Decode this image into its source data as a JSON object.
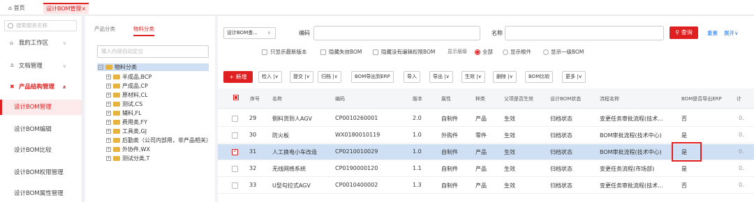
{
  "tabs": [
    {
      "label": "首页",
      "icon": "home-icon",
      "active": false
    },
    {
      "label": "设计BOM管理",
      "active": true,
      "close": "×"
    }
  ],
  "nav": {
    "search_placeholder": "搜索服务名称",
    "items": [
      {
        "label": "我的工作区",
        "icon": "home-icon"
      },
      {
        "label": "文档管理",
        "icon": "document-icon"
      },
      {
        "label": "产品结构管理",
        "icon": "structure-icon",
        "active": true
      }
    ],
    "sub_items": [
      {
        "label": "设计BOM管理",
        "active": true
      },
      {
        "label": "设计BOM编辑"
      },
      {
        "label": "设计BOM比较"
      },
      {
        "label": "设计BOM权限管理"
      },
      {
        "label": "设计BOM属性管理"
      }
    ]
  },
  "tree": {
    "tabs": [
      "产品分类",
      "物料分类"
    ],
    "active_tab": "物料分类",
    "search_placeholder": "输入内容自动定位",
    "root": "物料分类",
    "nodes": [
      "半成品,BCP",
      "产成品,CP",
      "原材料,CL",
      "测试,CS",
      "辅料,FL",
      "费用类,FY",
      "工具类,GJ",
      "后勤类（公司内部用，非产品相关）",
      "外协件,WX",
      "测试分类,T"
    ]
  },
  "filters": {
    "type_select": "设计BOM查...",
    "code_label": "编码",
    "name_label": "名称",
    "search_button": "查询",
    "reset_link": "重置",
    "expand_link": "展开∨",
    "checkboxes": [
      "只显示最新版本",
      "隐藏失效BOM",
      "隐藏没有编辑权限BOM"
    ],
    "level_label": "显示层级",
    "radios": [
      {
        "label": "全部",
        "checked": true
      },
      {
        "label": "显示根件",
        "checked": false
      },
      {
        "label": "显示一级BOM",
        "checked": false
      }
    ]
  },
  "toolbar": {
    "new_button": "+ 新增",
    "buttons": [
      "检入 |∨",
      "提交 |∨",
      "归档 |∨",
      "BOM导出到ERP",
      "导入",
      "导出 |∨",
      "生效 |∨",
      "删除 |∨",
      "BOM比较",
      "更多 |∨"
    ]
  },
  "table": {
    "headers": [
      "序号",
      "名称",
      "编码",
      "版本",
      "属性",
      "种类",
      "父项是否生效",
      "设计BOM状态",
      "流程名称",
      "BOM是否导出ERP",
      "计"
    ],
    "rows": [
      {
        "no": "29",
        "name": "侧料货到人AGV",
        "code": "CP0010260001",
        "ver": "2.0",
        "attr": "自制件",
        "kind": "产品",
        "effective": "生效",
        "status": "归档状态",
        "flow": "变更任务审批流程(技术...",
        "erp": "否",
        "extra": "0.",
        "selected": false
      },
      {
        "no": "30",
        "name": "防火板",
        "code": "WX0180010119",
        "ver": "1.0",
        "attr": "外购件",
        "kind": "零件",
        "effective": "生效",
        "status": "归档状态",
        "flow": "BOM审批流程(技术中心)",
        "erp": "是",
        "extra": "0.",
        "selected": false
      },
      {
        "no": "31",
        "name": "人工换电小车改造",
        "code": "CP0210010029",
        "ver": "1.0",
        "attr": "自制件",
        "kind": "产品",
        "effective": "生效",
        "status": "归档状态",
        "flow": "BOM审批流程(技术中心)",
        "erp": "是",
        "extra": "0.",
        "selected": true
      },
      {
        "no": "32",
        "name": "无线网络系统",
        "code": "CP0190000120",
        "ver": "1.1",
        "attr": "自制件",
        "kind": "产品",
        "effective": "生效",
        "status": "归档状态",
        "flow": "变更任务流程(市场部)",
        "erp": "是",
        "extra": "0.",
        "selected": false
      },
      {
        "no": "33",
        "name": "U型勾拉式AGV",
        "code": "CP0010400002",
        "ver": "1.3",
        "attr": "自制件",
        "kind": "产品",
        "effective": "生效",
        "status": "归档状态",
        "flow": "变更任务审批流程(技术...",
        "erp": "否",
        "extra": "0.",
        "selected": false
      }
    ]
  },
  "colors": {
    "accent": "#e02020",
    "selected_row": "#cfe0f5",
    "link": "#1a73e8"
  }
}
